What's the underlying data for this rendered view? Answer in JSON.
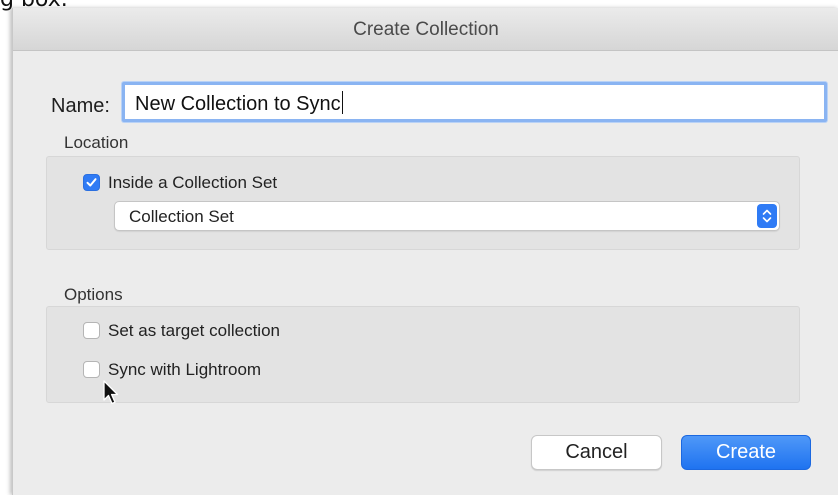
{
  "caption_fragment": "g box.",
  "dialog": {
    "title": "Create Collection",
    "name_label": "Name:",
    "name_value": "New Collection to Sync",
    "location": {
      "label": "Location",
      "inside_set_label": "Inside a Collection Set",
      "inside_set_checked": true,
      "collection_set_selected": "Collection Set"
    },
    "options": {
      "label": "Options",
      "target_label": "Set as target collection",
      "target_checked": false,
      "sync_label": "Sync with Lightroom",
      "sync_checked": false
    },
    "buttons": {
      "cancel": "Cancel",
      "create": "Create"
    }
  },
  "colors": {
    "accent": "#2f7bf5",
    "focus_ring": "#8ab4f2",
    "dialog_bg": "#ececec"
  },
  "icons": {
    "checkmark": "checkmark-icon",
    "stepper": "up-down-chevron-icon",
    "cursor": "mouse-pointer-icon"
  }
}
